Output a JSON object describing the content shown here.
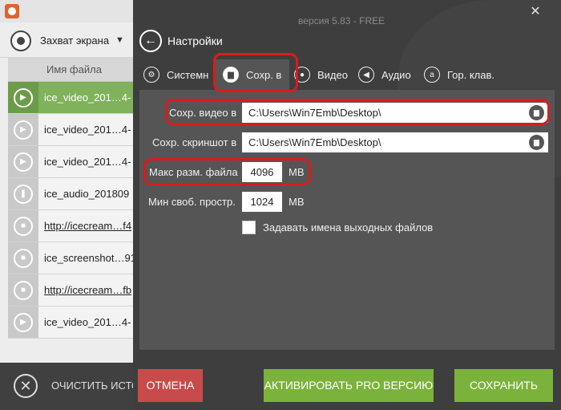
{
  "left_window": {
    "capture_label": "Захват экрана",
    "column_header": "Имя файла",
    "files": [
      {
        "name": "ice_video_201…4-",
        "type": "play-icon",
        "link": false,
        "selected": true
      },
      {
        "name": "ice_video_201…4-",
        "type": "play-icon",
        "link": false,
        "selected": false
      },
      {
        "name": "ice_video_201…4-",
        "type": "play-icon",
        "link": false,
        "selected": false
      },
      {
        "name": "ice_audio_201809",
        "type": "microphone-icon",
        "link": false,
        "selected": false
      },
      {
        "name": "http://icecream…f4",
        "type": "camera-icon",
        "link": true,
        "selected": false
      },
      {
        "name": "ice_screenshot…91",
        "type": "camera-icon",
        "link": false,
        "selected": false
      },
      {
        "name": "http://icecream…fb",
        "type": "camera-icon",
        "link": true,
        "selected": false
      },
      {
        "name": "ice_video_201…4-",
        "type": "play-icon",
        "link": false,
        "selected": false
      }
    ],
    "clear_label": "ОЧИСТИТЬ ИСТО"
  },
  "settings": {
    "version": "версия 5.83 - FREE",
    "title": "Настройки",
    "tabs": [
      {
        "label": "Системн",
        "icon": "gear-icon",
        "active": false
      },
      {
        "label": "Сохр. в",
        "icon": "folder-icon",
        "active": true
      },
      {
        "label": "Видео",
        "icon": "record-icon",
        "active": false
      },
      {
        "label": "Аудио",
        "icon": "speaker-icon",
        "active": false
      },
      {
        "label": "Гор. клав.",
        "icon": "hotkey-icon",
        "active": false
      }
    ],
    "save_video_label": "Сохр. видео в",
    "save_video_path": "C:\\Users\\Win7Emb\\Desktop\\",
    "save_screenshot_label": "Сохр. скриншот в",
    "save_screenshot_path": "C:\\Users\\Win7Emb\\Desktop\\",
    "max_file_size_label": "Макс разм. файла",
    "max_file_size_value": "4096",
    "max_file_size_unit": "MB",
    "min_free_space_label": "Мин своб. простр.",
    "min_free_space_value": "1024",
    "min_free_space_unit": "MB",
    "output_names_label": "Задавать имена выходных файлов",
    "output_names_checked": false,
    "cancel_label": "ОТМЕНА",
    "pro_label": "АКТИВИРОВАТЬ PRO ВЕРСИЮ",
    "save_label": "СОХРАНИТЬ"
  },
  "colors": {
    "highlight": "#d81c1c",
    "accent_green": "#7bb23b",
    "cancel_red": "#c84b4b"
  }
}
